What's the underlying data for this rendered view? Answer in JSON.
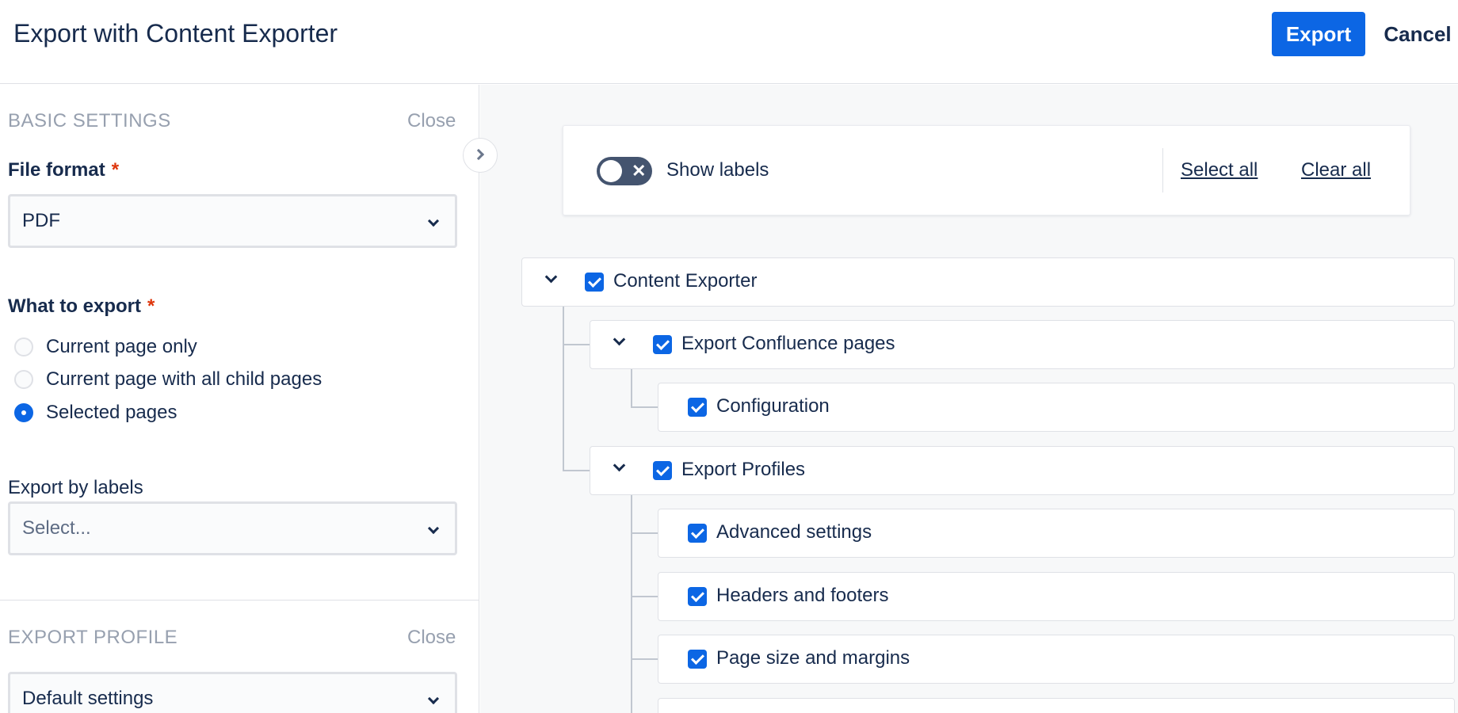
{
  "header": {
    "title": "Export with Content Exporter",
    "export_label": "Export",
    "cancel_label": "Cancel"
  },
  "basic_settings": {
    "heading": "BASIC SETTINGS",
    "close_label": "Close",
    "file_format": {
      "label": "File format",
      "required_mark": "*",
      "value": "PDF"
    },
    "what_to_export": {
      "label": "What to export",
      "required_mark": "*",
      "options": [
        {
          "label": "Current page only",
          "selected": false
        },
        {
          "label": "Current page with all child pages",
          "selected": false
        },
        {
          "label": "Selected pages",
          "selected": true
        }
      ]
    },
    "export_by_labels": {
      "label": "Export by labels",
      "placeholder": "Select..."
    }
  },
  "export_profile": {
    "heading": "EXPORT PROFILE",
    "close_label": "Close",
    "value": "Default settings"
  },
  "toolbar": {
    "show_labels_label": "Show labels",
    "show_labels_on": false,
    "select_all_label": "Select all",
    "clear_all_label": "Clear all"
  },
  "tree": [
    {
      "label": "Content Exporter",
      "checked": true,
      "expanded": true
    },
    {
      "label": "Export Confluence pages",
      "checked": true,
      "expanded": true
    },
    {
      "label": "Configuration",
      "checked": true
    },
    {
      "label": "Export Profiles",
      "checked": true,
      "expanded": true
    },
    {
      "label": "Advanced settings",
      "checked": true
    },
    {
      "label": "Headers and footers",
      "checked": true
    },
    {
      "label": "Page size and margins",
      "checked": true
    },
    {
      "label": "",
      "checked": true
    }
  ],
  "colors": {
    "primary": "#0c66e4",
    "text": "#172b4d",
    "required": "#de350b",
    "muted": "#97a0af"
  }
}
